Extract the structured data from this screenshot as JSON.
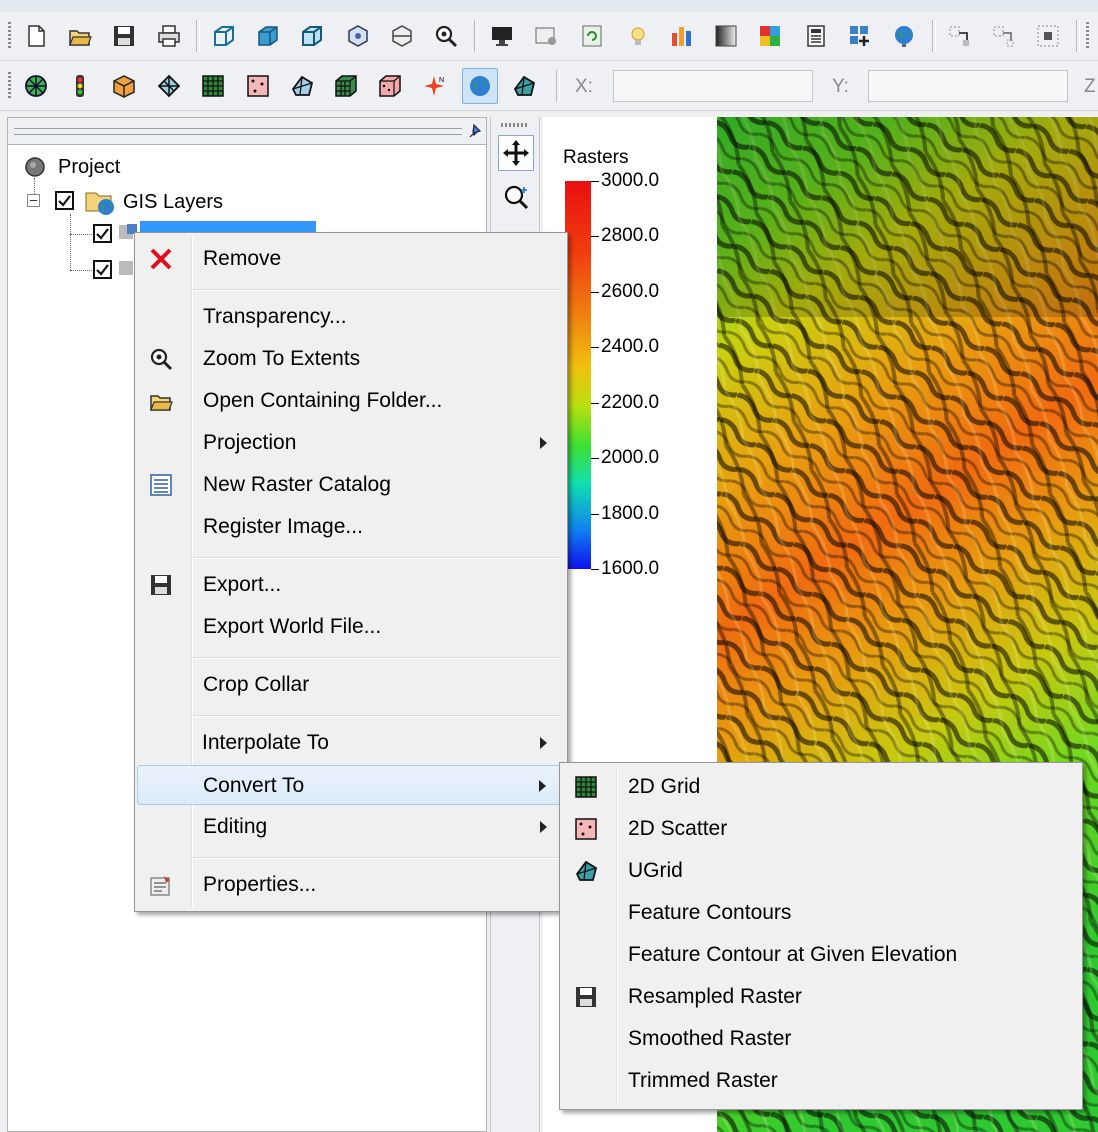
{
  "toolbar": {
    "icons_row1": [
      "new-file-icon",
      "open-folder-icon",
      "save-icon",
      "print-icon",
      "wireframe-cube-icon",
      "solid-cube-icon",
      "cube-outline-icon",
      "cube-nodes-icon",
      "cube-cut-icon",
      "zoom-extents-icon",
      "monitor-icon",
      "certificate-icon",
      "refresh-icon",
      "light-bulb-icon",
      "bar-chart-icon",
      "gradient-square-icon",
      "color-grid-icon",
      "calculator-icon",
      "add-layout-icon",
      "globe-icon",
      "move-selection-icon",
      "dashed-selection-icon",
      "grid-select-icon"
    ],
    "icons_row2": [
      "mesh-circle-icon",
      "traffic-light-icon",
      "box-icon",
      "tin-icon",
      "2d-grid-icon",
      "2d-scatter-icon",
      "ugrid-shape-icon",
      "3d-grid-icon",
      "dice-icon",
      "north-arrow-icon",
      "gis-globe-icon",
      "ugrid-icon"
    ]
  },
  "coords": {
    "x_label": "X:",
    "y_label": "Y:",
    "z_label": "Z"
  },
  "tree": {
    "project": "Project",
    "gis_layers": "GIS Layers"
  },
  "legend": {
    "title": "Rasters",
    "labels": [
      "3000.0",
      "2800.0",
      "2600.0",
      "2400.0",
      "2200.0",
      "2000.0",
      "1800.0",
      "1600.0"
    ]
  },
  "context_menu": {
    "remove": "Remove",
    "transparency": "Transparency...",
    "zoom_to_extents": "Zoom To Extents",
    "open_folder": "Open Containing Folder...",
    "projection": "Projection",
    "new_raster_catalog": "New Raster Catalog",
    "register_image": "Register Image...",
    "export": "Export...",
    "export_world_file": "Export World File...",
    "crop_collar": "Crop Collar",
    "interpolate_to": "Interpolate To",
    "convert_to": "Convert To",
    "editing": "Editing",
    "properties": "Properties..."
  },
  "submenu": {
    "grid_2d": "2D Grid",
    "scatter_2d": "2D Scatter",
    "ugrid": "UGrid",
    "feature_contours": "Feature Contours",
    "feature_contour_elev": "Feature Contour at Given Elevation",
    "resampled_raster": "Resampled Raster",
    "smoothed_raster": "Smoothed Raster",
    "trimmed_raster": "Trimmed Raster"
  },
  "colors": {
    "highlight": "#3399ff",
    "remove_x": "#e0101a"
  }
}
